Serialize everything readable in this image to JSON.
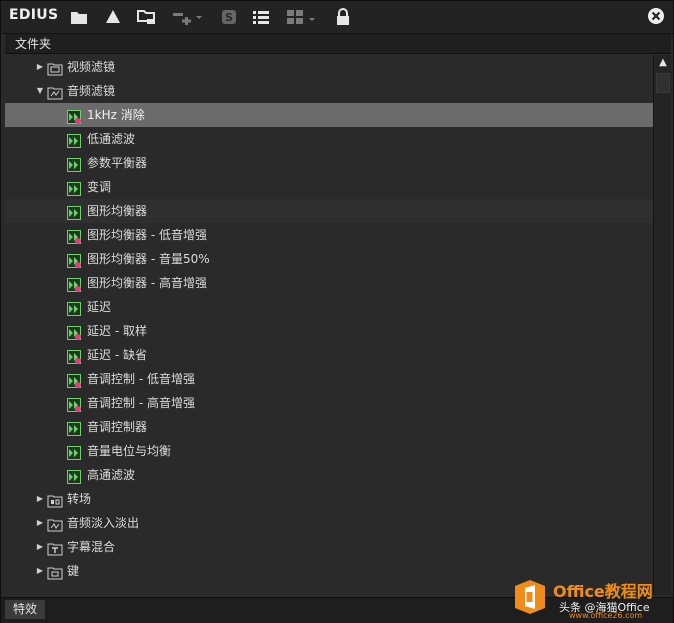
{
  "toolbar": {
    "brand": "EDIUS",
    "icons": [
      "folder-icon",
      "warning-icon",
      "folder-network-icon",
      "add-dropdown-icon",
      "s-icon",
      "list-icon",
      "grid-icon",
      "lock-icon",
      "close-icon"
    ]
  },
  "panel": {
    "header": "文件夹",
    "footer_tab": "特效"
  },
  "tree": {
    "folders": [
      {
        "label": "视频滤镜"
      },
      {
        "label": "音频滤镜"
      },
      {
        "label": "转场"
      },
      {
        "label": "音频淡入淡出"
      },
      {
        "label": "字幕混合"
      },
      {
        "label": "键"
      }
    ],
    "audio_filters": [
      {
        "label": "1kHz 消除",
        "badge": true
      },
      {
        "label": "低通滤波",
        "badge": false
      },
      {
        "label": "参数平衡器",
        "badge": false
      },
      {
        "label": "变调",
        "badge": false
      },
      {
        "label": "图形均衡器",
        "badge": false
      },
      {
        "label": "图形均衡器 - 低音增强",
        "badge": true
      },
      {
        "label": "图形均衡器 - 音量50%",
        "badge": true
      },
      {
        "label": "图形均衡器 - 高音增强",
        "badge": true
      },
      {
        "label": "延迟",
        "badge": false
      },
      {
        "label": "延迟 - 取样",
        "badge": true
      },
      {
        "label": "延迟 - 缺省",
        "badge": true
      },
      {
        "label": "音调控制 - 低音增强",
        "badge": true
      },
      {
        "label": "音调控制 - 高音增强",
        "badge": true
      },
      {
        "label": "音调控制器",
        "badge": false
      },
      {
        "label": "音量电位与均衡",
        "badge": false
      },
      {
        "label": "高通滤波",
        "badge": false
      }
    ]
  },
  "watermark": {
    "title": "Office教程网",
    "subtitle": "头条 @海猫Office",
    "url": "www.office26.com"
  },
  "colors": {
    "selected_row": "#6b6b6b",
    "fx_green": "#6fd06f",
    "badge_red": "#e23a7a",
    "accent_orange": "#f08c1a"
  }
}
